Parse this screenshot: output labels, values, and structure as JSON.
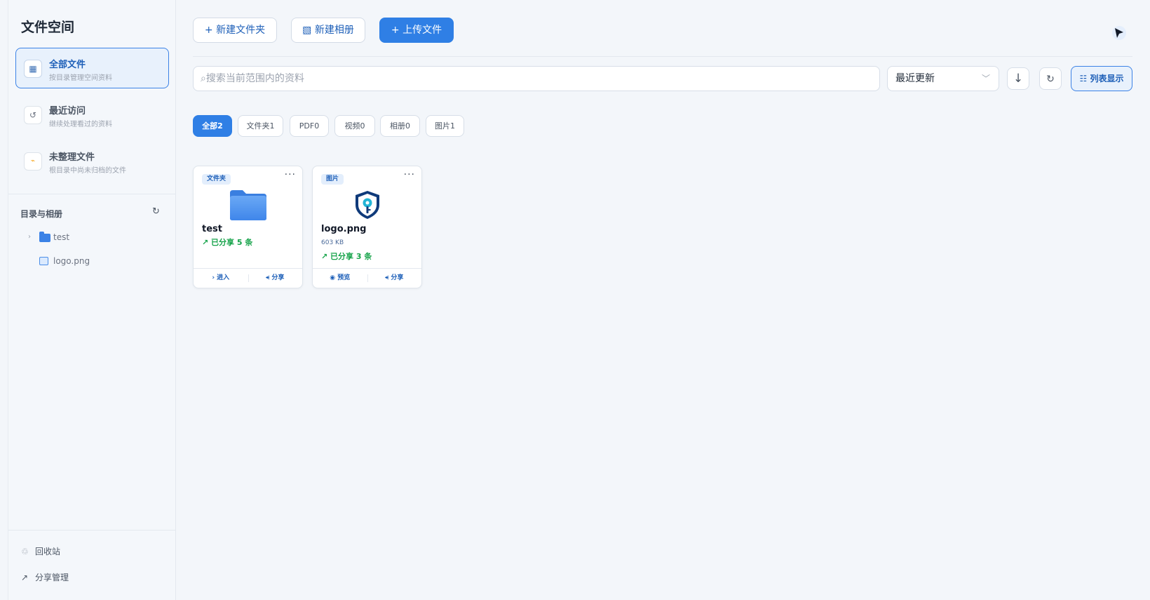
{
  "sidebar": {
    "title": "文件空间",
    "nav": [
      {
        "label": "全部文件",
        "sub": "按目录管理空间资料",
        "icon": "grid-icon",
        "active": true
      },
      {
        "label": "最近访问",
        "sub": "继续处理看过的资料",
        "icon": "history-icon"
      },
      {
        "label": "未整理文件",
        "sub": "根目录中尚未归档的文件",
        "icon": "arrow-icon"
      }
    ],
    "section_title": "目录与相册",
    "tree": [
      {
        "label": "test",
        "type": "folder"
      },
      {
        "label": "logo.png",
        "type": "image"
      }
    ],
    "footer": [
      {
        "label": "回收站",
        "icon": "recycle-icon"
      },
      {
        "label": "分享管理",
        "icon": "share-arrow-icon"
      }
    ]
  },
  "toolbar": {
    "new_folder": "+ 新建文件夹",
    "new_album": "▧ 新建相册",
    "upload": "+ 上传文件"
  },
  "search": {
    "placeholder": "⌕搜索当前范围内的资料"
  },
  "sort": {
    "selected": "最近更新"
  },
  "view_toggle": "☷ 列表显示",
  "filters": [
    {
      "label": "全部2",
      "active": true
    },
    {
      "label": "文件夹1"
    },
    {
      "label": "PDF0"
    },
    {
      "label": "视频0"
    },
    {
      "label": "相册0"
    },
    {
      "label": "图片1"
    }
  ],
  "cards": [
    {
      "badge": "文件夹",
      "name": "test",
      "size": "",
      "share": "↗ 已分享 5 条",
      "action_left": "› 进入",
      "action_right": "⪪ 分享"
    },
    {
      "badge": "图片",
      "name": "logo.png",
      "size": "603 KB",
      "share": "↗ 已分享 3 条",
      "action_left": "◉ 预览",
      "action_right": "⪪ 分享"
    }
  ],
  "colors": {
    "accent": "#2f7fe5",
    "share_green": "#16a34a"
  }
}
